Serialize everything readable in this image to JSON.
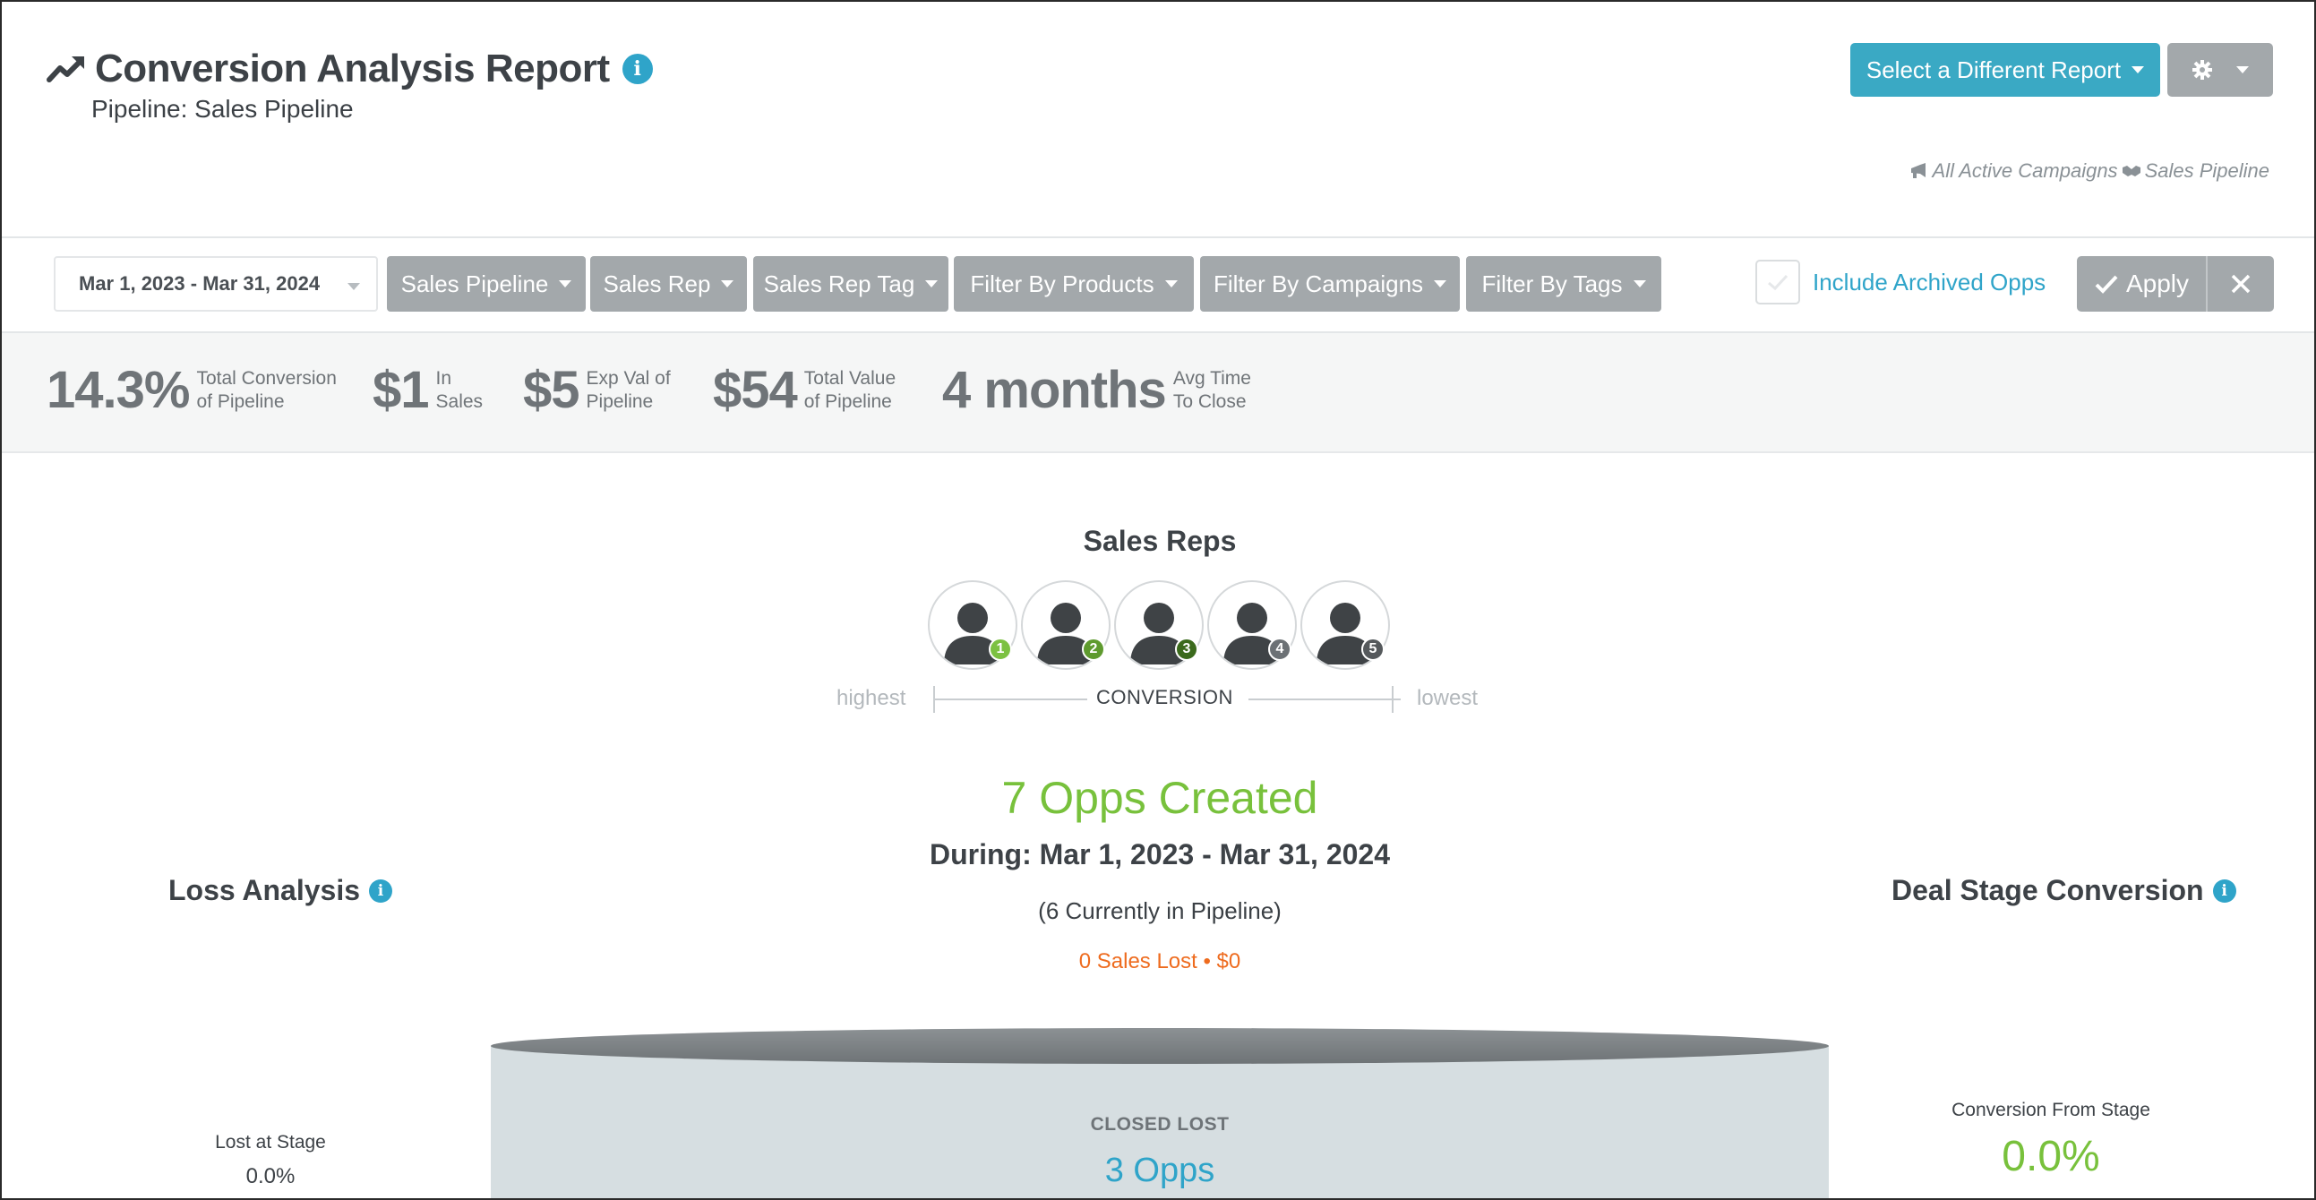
{
  "header": {
    "title": "Conversion Analysis Report",
    "subtitle": "Pipeline: Sales Pipeline",
    "select_report_label": "Select a Different Report",
    "campaigns_label": "All Active Campaigns",
    "pipeline_label": "Sales Pipeline"
  },
  "filters": {
    "date_range": "Mar 1, 2023 - Mar 31, 2024",
    "buttons": [
      "Sales Pipeline",
      "Sales Rep",
      "Sales Rep Tag",
      "Filter By Products",
      "Filter By Campaigns",
      "Filter By Tags"
    ],
    "include_archived_label": "Include Archived Opps",
    "include_archived_checked": false,
    "apply_label": "Apply"
  },
  "stats": [
    {
      "value": "14.3%",
      "label_line1": "Total Conversion",
      "label_line2": "of Pipeline"
    },
    {
      "value": "$1",
      "label_line1": "In",
      "label_line2": "Sales"
    },
    {
      "value": "$5",
      "label_line1": "Exp Val of",
      "label_line2": "Pipeline"
    },
    {
      "value": "$54",
      "label_line1": "Total Value",
      "label_line2": "of Pipeline"
    },
    {
      "value": "4 months",
      "label_line1": "Avg Time",
      "label_line2": "To Close"
    }
  ],
  "sales_reps": {
    "title": "Sales Reps",
    "ranks": [
      "1",
      "2",
      "3",
      "4",
      "5"
    ],
    "rank_colors": [
      "#7cc142",
      "#5e9a2e",
      "#3b6a1c",
      "#6c7175",
      "#55595c"
    ],
    "scale_high": "highest",
    "scale_center": "CONVERSION",
    "scale_low": "lowest"
  },
  "summary": {
    "opps_created": "7 Opps Created",
    "during": "During: Mar 1, 2023 - Mar 31, 2024",
    "in_pipeline": "(6 Currently in Pipeline)",
    "lost": "0 Sales Lost • $0"
  },
  "loss_analysis": {
    "title": "Loss Analysis",
    "lost_at_stage_label": "Lost at Stage",
    "lost_at_stage_value": "0.0%"
  },
  "deal_stage_conversion": {
    "title": "Deal Stage Conversion",
    "conversion_from_stage_label": "Conversion From Stage",
    "conversion_from_stage_value": "0.0%"
  },
  "funnel": {
    "stage_name": "CLOSED LOST",
    "stage_opps": "3 Opps"
  },
  "colors": {
    "accent": "#3aa9c4",
    "green": "#78c13c",
    "orange": "#ee6b1e",
    "gray_button": "#a3a8ab"
  }
}
